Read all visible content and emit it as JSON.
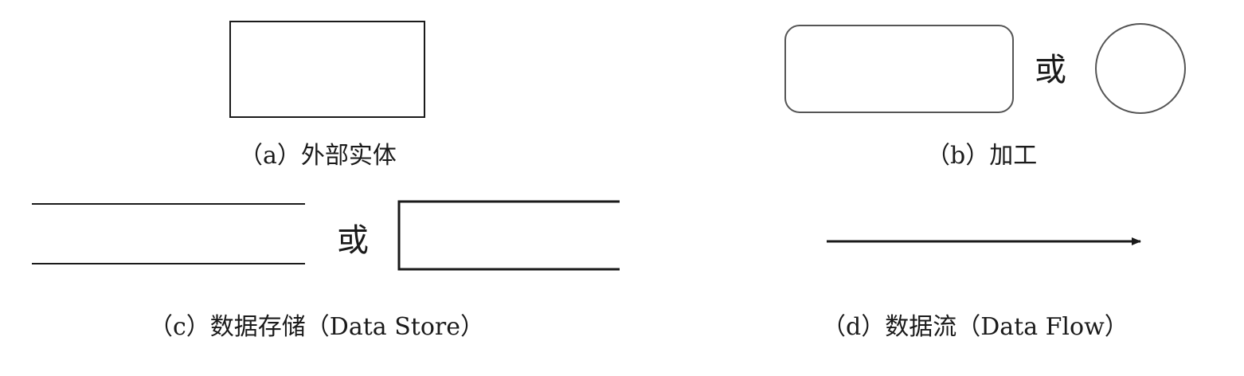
{
  "symbols": {
    "external_entity": {
      "caption": "（a）外部实体"
    },
    "process": {
      "caption": "（b）加工",
      "or_label": "或"
    },
    "data_store": {
      "caption": "（c）数据存储（Data Store）",
      "or_label": "或"
    },
    "data_flow": {
      "caption": "（d）数据流（Data Flow）"
    }
  },
  "colors": {
    "stroke": "#1a1a1a",
    "process_stroke": "#555555",
    "background": "#ffffff"
  }
}
